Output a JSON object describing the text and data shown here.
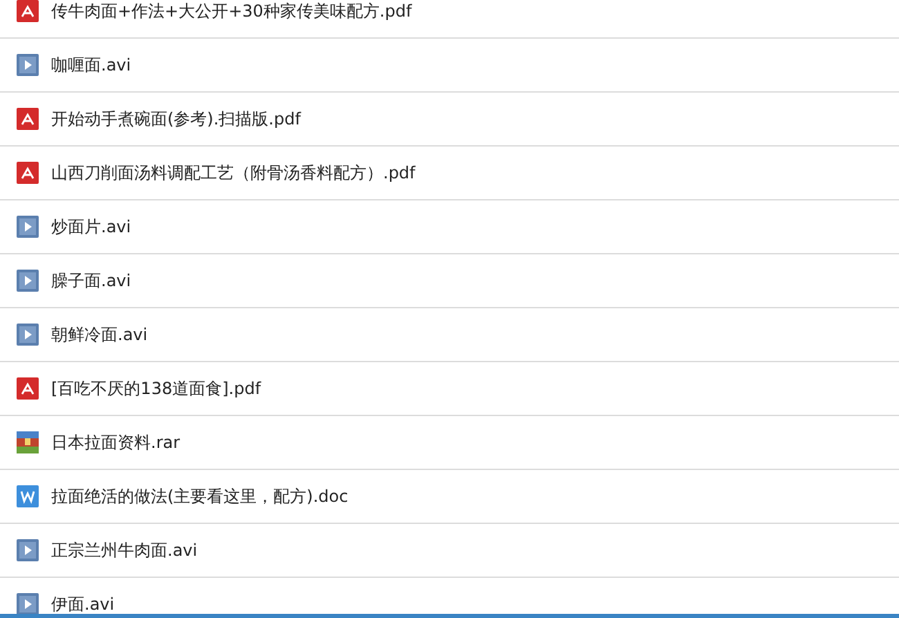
{
  "files": [
    {
      "kind": "pdf",
      "name": "传牛肉面+作法+大公开+30种家传美味配方.pdf"
    },
    {
      "kind": "video",
      "name": "咖喱面.avi"
    },
    {
      "kind": "pdf",
      "name": "开始动手煮碗面(参考).扫描版.pdf"
    },
    {
      "kind": "pdf",
      "name": "山西刀削面汤料调配工艺（附骨汤香料配方）.pdf"
    },
    {
      "kind": "video",
      "name": "炒面片.avi"
    },
    {
      "kind": "video",
      "name": "臊子面.avi"
    },
    {
      "kind": "video",
      "name": "朝鲜冷面.avi"
    },
    {
      "kind": "pdf",
      "name": "[百吃不厌的138道面食].pdf"
    },
    {
      "kind": "archive",
      "name": "日本拉面资料.rar"
    },
    {
      "kind": "doc",
      "name": "拉面绝活的做法(主要看这里，配方).doc"
    },
    {
      "kind": "video",
      "name": "正宗兰州牛肉面.avi"
    },
    {
      "kind": "video",
      "name": "伊面.avi"
    }
  ]
}
